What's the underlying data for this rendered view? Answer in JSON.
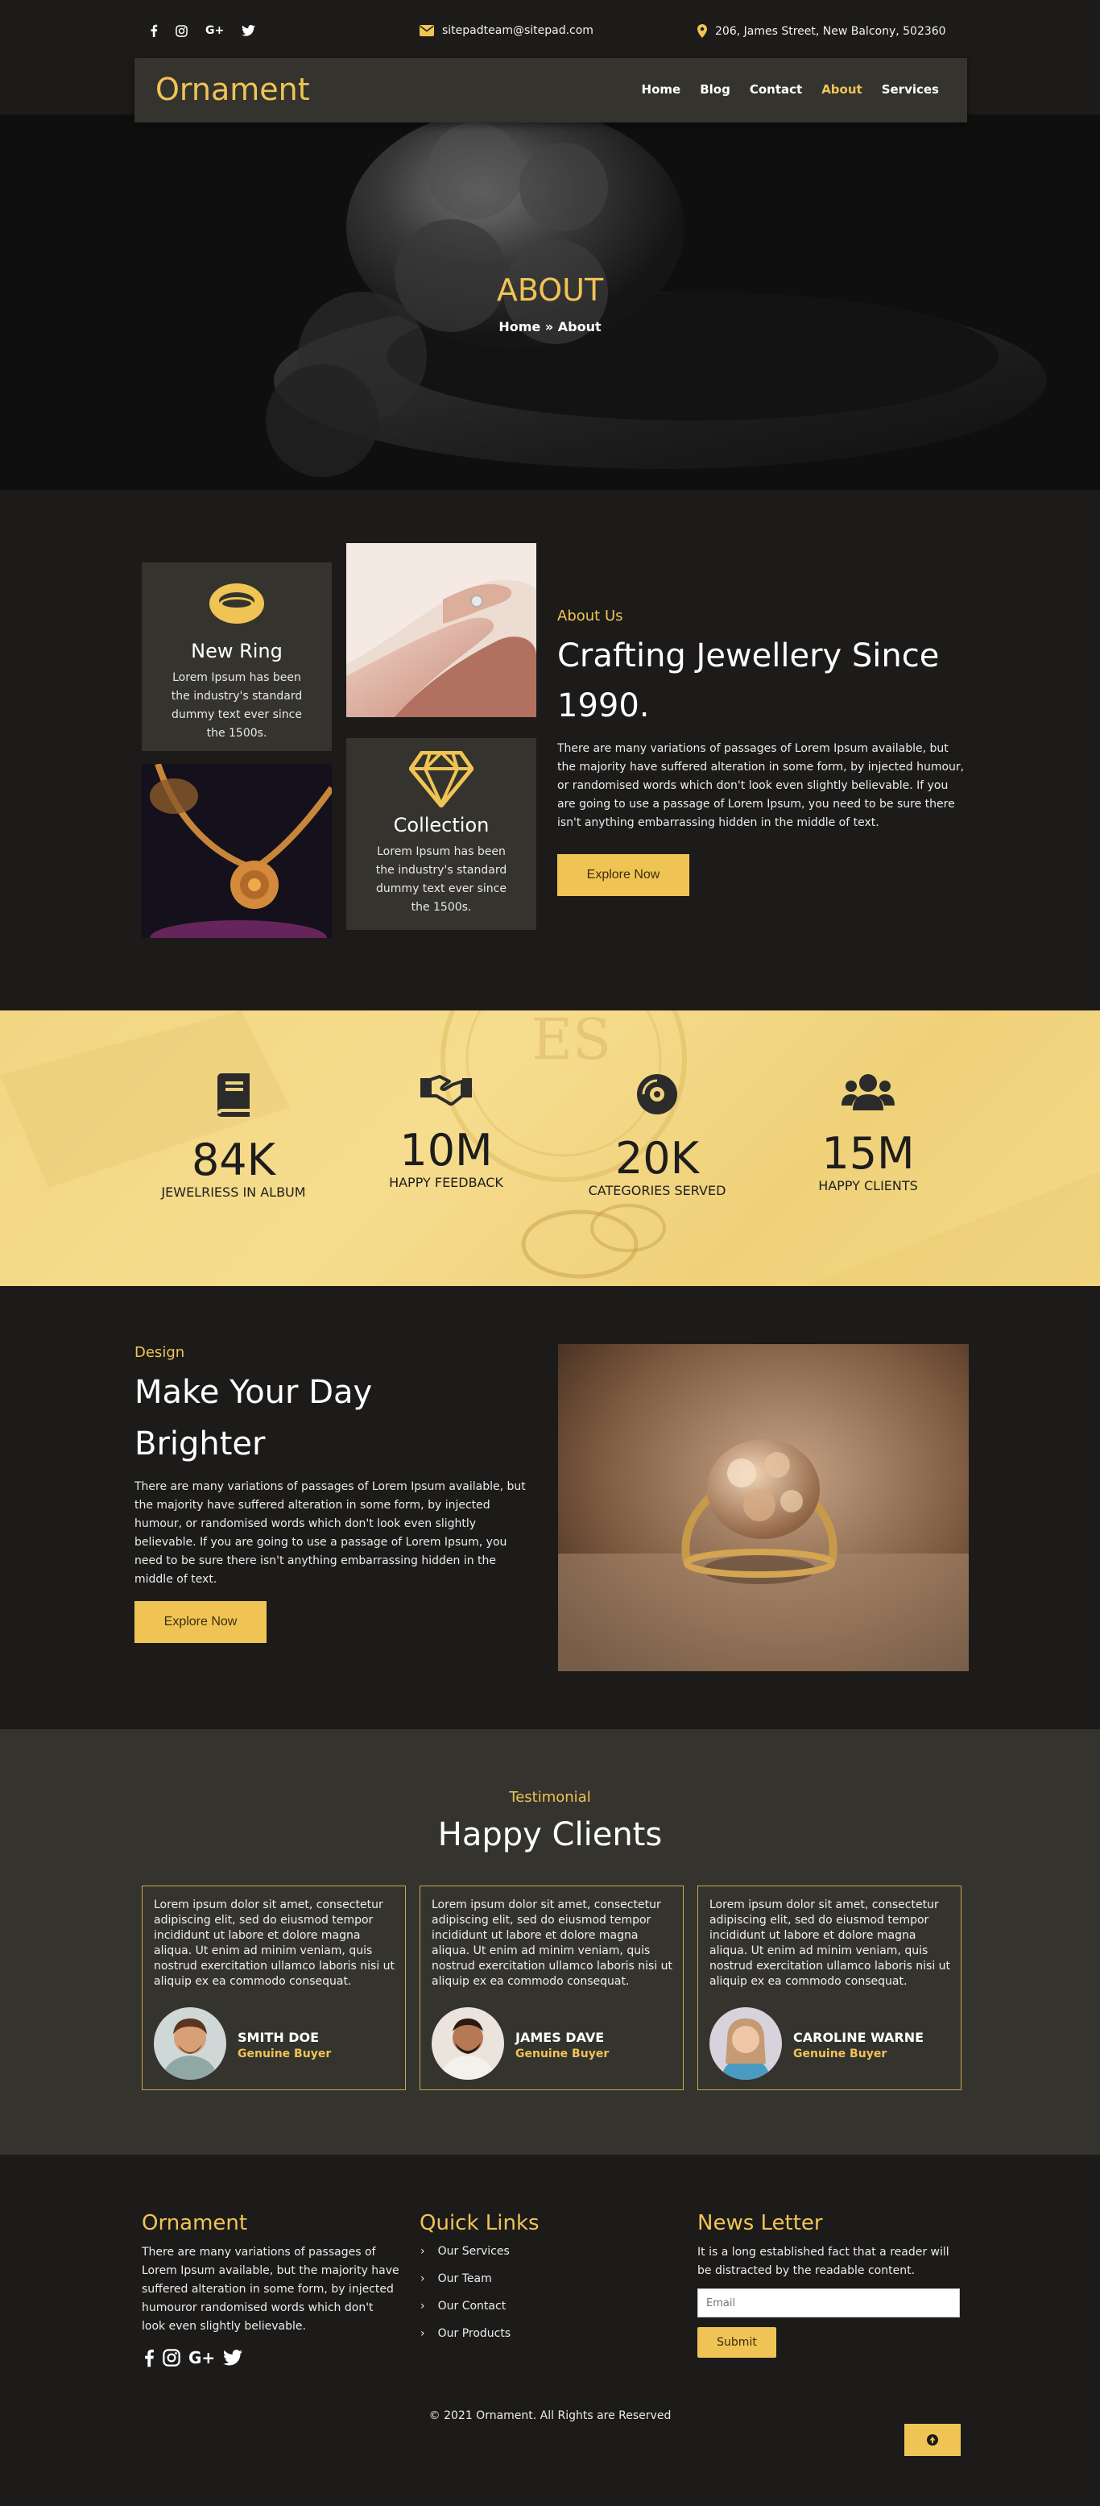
{
  "topbar": {
    "social": [
      "facebook-icon",
      "instagram-icon",
      "google-plus-icon",
      "twitter-icon"
    ],
    "email": "sitepadteam@sitepad.com",
    "address": "206, James Street, New Balcony, 502360"
  },
  "nav": {
    "brand": "Ornament",
    "items": [
      {
        "label": "Home",
        "active": false
      },
      {
        "label": "Blog",
        "active": false
      },
      {
        "label": "Contact",
        "active": false
      },
      {
        "label": "About",
        "active": true
      },
      {
        "label": "Services",
        "active": false
      }
    ]
  },
  "hero": {
    "title": "ABOUT",
    "crumb_home": "Home",
    "crumb_sep": "»",
    "crumb_current": "About"
  },
  "about": {
    "card1": {
      "title": "New Ring",
      "text": "Lorem Ipsum has been the industry's standard dummy text ever since the 1500s.",
      "icon": "ring-icon"
    },
    "card2": {
      "title": "Collection",
      "text": "Lorem Ipsum has been the industry's standard dummy text ever since the 1500s.",
      "icon": "diamond-icon"
    },
    "label": "About Us",
    "heading_line1": "Crafting Jewellery Since",
    "heading_line2": "1990.",
    "paragraph": "There are many variations of passages of Lorem Ipsum available, but the majority have suffered alteration in some form, by injected humour, or randomised words which don't look even slightly believable. If you are going to use a passage of Lorem Ipsum, you need to be sure there isn't anything embarrassing hidden in the middle of text.",
    "button": "Explore Now"
  },
  "stats": [
    {
      "icon": "book-icon",
      "value": "84K",
      "label": "JEWELRIESS IN ALBUM"
    },
    {
      "icon": "handshake-icon",
      "value": "10M",
      "label": "HAPPY FEEDBACK"
    },
    {
      "icon": "compact-disc-icon",
      "value": "20K",
      "label": "CATEGORIES SERVED"
    },
    {
      "icon": "users-icon",
      "value": "15M",
      "label": "HAPPY CLIENTS"
    }
  ],
  "design": {
    "label": "Design",
    "heading_line1": "Make Your Day",
    "heading_line2": "Brighter",
    "paragraph": "There are many variations of passages of Lorem Ipsum available, but the majority have suffered alteration in some form, by injected humour, or randomised words which don't look even slightly believable. If you are going to use a passage of Lorem Ipsum, you need to be sure there isn't anything embarrassing hidden in the middle of text.",
    "button": "Explore Now"
  },
  "testimonial": {
    "label": "Testimonial",
    "heading": "Happy Clients",
    "items": [
      {
        "text": "Lorem ipsum dolor sit amet, consectetur adipiscing elit, sed do eiusmod tempor incididunt ut labore et dolore magna aliqua. Ut enim ad minim veniam, quis nostrud exercitation ullamco laboris nisi ut aliquip ex ea commodo consequat.",
        "name": "SMITH DOE",
        "role": "Genuine Buyer"
      },
      {
        "text": "Lorem ipsum dolor sit amet, consectetur adipiscing elit, sed do eiusmod tempor incididunt ut labore et dolore magna aliqua. Ut enim ad minim veniam, quis nostrud exercitation ullamco laboris nisi ut aliquip ex ea commodo consequat.",
        "name": "JAMES DAVE",
        "role": "Genuine Buyer"
      },
      {
        "text": "Lorem ipsum dolor sit amet, consectetur adipiscing elit, sed do eiusmod tempor incididunt ut labore et dolore magna aliqua. Ut enim ad minim veniam, quis nostrud exercitation ullamco laboris nisi ut aliquip ex ea commodo consequat.",
        "name": "CAROLINE WARNE",
        "role": "Genuine Buyer"
      }
    ]
  },
  "footer": {
    "brand": "Ornament",
    "about": "There are many variations of passages of Lorem Ipsum available, but the majority have suffered alteration in some form, by injected humouror randomised words which don't look even slightly believable.",
    "quick_links_title": "Quick Links",
    "links": [
      "Our Services",
      "Our Team",
      "Our Contact",
      "Our Products"
    ],
    "newsletter_title": "News Letter",
    "newsletter_text": "It is a long established fact that a reader will be distracted by the readable content.",
    "email_placeholder": "Email",
    "submit": "Submit",
    "copyright": "© 2021 Ornament. All Rights are Reserved"
  },
  "colors": {
    "accent": "#f0c454",
    "dark": "#1c1b1a",
    "panel": "#34332e"
  }
}
